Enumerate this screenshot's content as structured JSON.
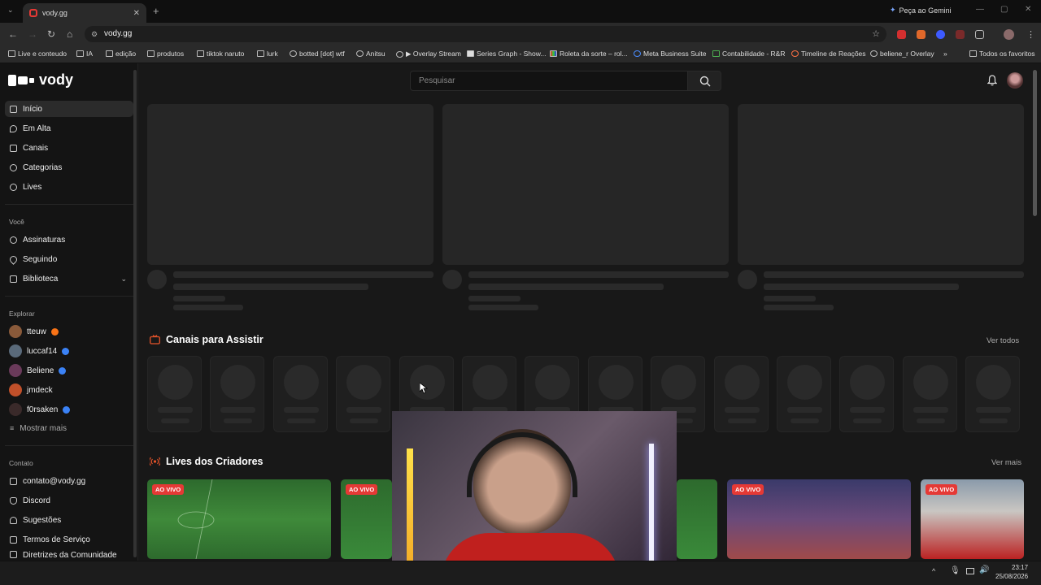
{
  "browser": {
    "tab_title": "vody.gg",
    "new_tab": "+",
    "gemini": "Peça ao Gemini",
    "url": "vody.gg",
    "bookmarks": [
      "Live e conteudo",
      "IA",
      "edição",
      "produtos",
      "tiktok naruto",
      "lurk",
      "botted [dot] wtf",
      "Anitsu",
      "▶ Overlay Stream",
      "Series Graph - Show...",
      "Roleta da sorte – rol...",
      "Meta Business Suite",
      "Contabilidade - R&R",
      "Timeline de Reações",
      "beliene_r Overlay"
    ],
    "bookmarks_more": "»",
    "all_favorites": "Todos os favoritos"
  },
  "app": {
    "logo": "vody",
    "search_placeholder": "Pesquisar",
    "nav": [
      {
        "label": "Início",
        "icon": "home-icon"
      },
      {
        "label": "Em Alta",
        "icon": "flame-icon"
      },
      {
        "label": "Canais",
        "icon": "tv-icon"
      },
      {
        "label": "Categorias",
        "icon": "compass-icon"
      },
      {
        "label": "Lives",
        "icon": "broadcast-icon"
      }
    ],
    "you_title": "Você",
    "you": [
      {
        "label": "Assinaturas",
        "icon": "users-icon"
      },
      {
        "label": "Seguindo",
        "icon": "heart-icon"
      },
      {
        "label": "Biblioteca",
        "icon": "library-icon"
      }
    ],
    "explore_title": "Explorar",
    "channels": [
      {
        "name": "tteuw",
        "badge": "orange"
      },
      {
        "name": "luccaf14",
        "badge": "blue"
      },
      {
        "name": "Beliene",
        "badge": "blue"
      },
      {
        "name": "jmdeck",
        "badge": "none"
      },
      {
        "name": "f0rsaken",
        "badge": "blue"
      }
    ],
    "show_more": "Mostrar mais",
    "contact_title": "Contato",
    "contact": [
      {
        "label": "contato@vody.gg",
        "icon": "mail-icon"
      },
      {
        "label": "Discord",
        "icon": "discord-icon"
      },
      {
        "label": "Sugestões",
        "icon": "lightbulb-icon"
      },
      {
        "label": "Termos de Serviço",
        "icon": "document-icon"
      },
      {
        "label": "Diretrizes da Comunidade",
        "icon": "shield-icon"
      }
    ],
    "section_channels": "Canais para Assistir",
    "see_all": "Ver todos",
    "section_lives": "Lives dos Criadores",
    "see_more": "Ver mais",
    "live_badge": "AO VIVO"
  },
  "taskbar": {
    "time": "23:17",
    "date": "25/08/2026"
  },
  "colors": {
    "accent_live": "#e53935",
    "section_icon": "#e8542a",
    "verified": "#3b82f6"
  }
}
